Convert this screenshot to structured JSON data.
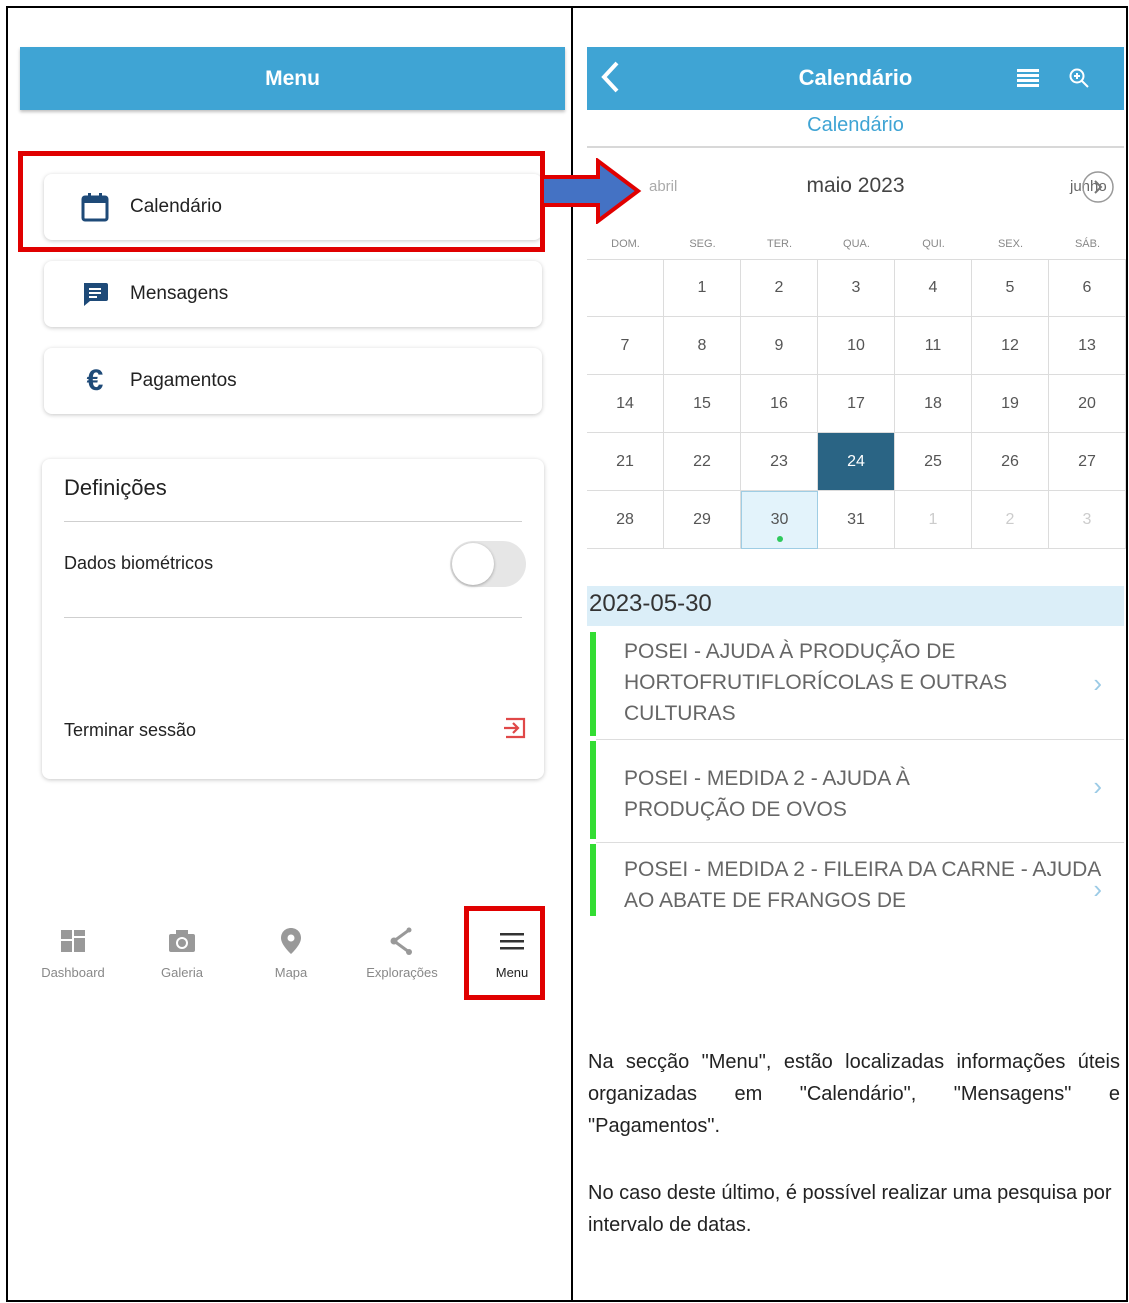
{
  "left": {
    "header_title": "Menu",
    "menu_items": [
      {
        "label": "Calendário",
        "icon": "calendar-icon"
      },
      {
        "label": "Mensagens",
        "icon": "message-icon"
      },
      {
        "label": "Pagamentos",
        "icon": "euro-icon"
      }
    ],
    "settings": {
      "title": "Definições",
      "biometric_label": "Dados biométricos",
      "biometric_enabled": false,
      "logout_label": "Terminar sessão"
    },
    "bottom_nav": [
      {
        "label": "Dashboard",
        "icon": "dashboard-icon"
      },
      {
        "label": "Galeria",
        "icon": "camera-icon"
      },
      {
        "label": "Mapa",
        "icon": "map-pin-icon"
      },
      {
        "label": "Explorações",
        "icon": "share-icon"
      },
      {
        "label": "Menu",
        "icon": "hamburger-icon",
        "active": true
      }
    ]
  },
  "right": {
    "header_title": "Calendário",
    "subtitle": "Calendário",
    "prev_month": "abril",
    "current_month": "maio 2023",
    "next_month": "junho",
    "weekdays": [
      "DOM.",
      "SEG.",
      "TER.",
      "QUA.",
      "QUI.",
      "SEX.",
      "SÁB."
    ],
    "days": [
      [
        "",
        "1",
        "2",
        "3",
        "4",
        "5",
        "6"
      ],
      [
        "7",
        "8",
        "9",
        "10",
        "11",
        "12",
        "13"
      ],
      [
        "14",
        "15",
        "16",
        "17",
        "18",
        "19",
        "20"
      ],
      [
        "21",
        "22",
        "23",
        "24",
        "25",
        "26",
        "27"
      ],
      [
        "28",
        "29",
        "30",
        "31",
        "1",
        "2",
        "3"
      ]
    ],
    "selected_day": "24",
    "event_day": "30",
    "date_heading": "2023-05-30",
    "events": [
      {
        "title": "POSEI - AJUDA À PRODUÇÃO DE HORTOFRUTIFLORÍCOLAS E OUTRAS CULTURAS"
      },
      {
        "title": "POSEI - MEDIDA 2 - AJUDA À PRODUÇÃO DE OVOS"
      },
      {
        "title": "POSEI - MEDIDA 2 - FILEIRA DA CARNE - AJUDA AO ABATE DE FRANGOS DE"
      }
    ],
    "description_1": "Na secção \"Menu\", estão localizadas informações úteis organizadas em \"Calendário\", \"Mensagens\" e \"Pagamentos\".",
    "description_2": "No caso deste último, é possível realizar uma pesquisa por intervalo de datas."
  },
  "colors": {
    "header": "#3fa4d4",
    "highlight": "#e00000",
    "arrow": "#4472c4",
    "selected_day": "#2a6484",
    "event_bar": "#33dd33"
  }
}
